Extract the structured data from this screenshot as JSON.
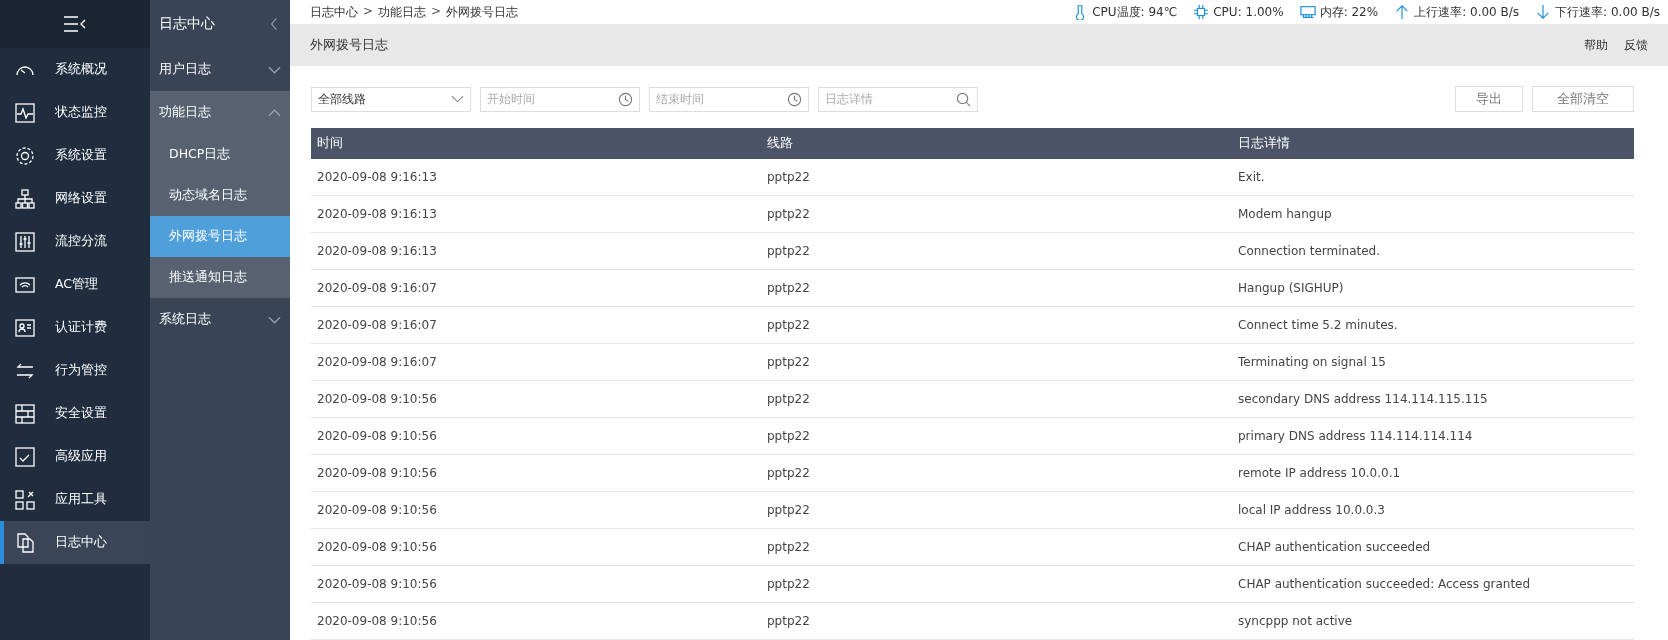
{
  "nav": {
    "items": [
      {
        "label": "系统概况",
        "selected": false
      },
      {
        "label": "状态监控",
        "selected": false
      },
      {
        "label": "系统设置",
        "selected": false
      },
      {
        "label": "网络设置",
        "selected": false
      },
      {
        "label": "流控分流",
        "selected": false
      },
      {
        "label": "AC管理",
        "selected": false
      },
      {
        "label": "认证计费",
        "selected": false
      },
      {
        "label": "行为管控",
        "selected": false
      },
      {
        "label": "安全设置",
        "selected": false
      },
      {
        "label": "高级应用",
        "selected": false
      },
      {
        "label": "应用工具",
        "selected": false
      },
      {
        "label": "日志中心",
        "selected": true
      }
    ]
  },
  "subnav": {
    "title": "日志中心",
    "groups": [
      {
        "label": "用户日志",
        "expanded": false
      },
      {
        "label": "功能日志",
        "expanded": true,
        "children": [
          {
            "label": "DHCP日志",
            "selected": false
          },
          {
            "label": "动态域名日志",
            "selected": false
          },
          {
            "label": "外网拨号日志",
            "selected": true
          },
          {
            "label": "推送通知日志",
            "selected": false
          }
        ]
      },
      {
        "label": "系统日志",
        "expanded": false
      }
    ]
  },
  "breadcrumb": [
    {
      "kind": "link",
      "label": "日志中心"
    },
    {
      "kind": "separator",
      "label": ">"
    },
    {
      "kind": "link",
      "label": "功能日志"
    },
    {
      "kind": "separator",
      "label": ">"
    },
    {
      "kind": "current",
      "label": "外网拨号日志"
    }
  ],
  "status": [
    "CPU温度: 94℃",
    "CPU: 1.00%",
    "内存: 22%",
    "上行速率: 0.00 B/s",
    "下行速率: 0.00 B/s"
  ],
  "page_title": "外网拨号日志",
  "header_links": [
    "帮助",
    "反馈"
  ],
  "filters": {
    "line": "全部线路",
    "start": {
      "placeholder": "开始时间"
    },
    "end": {
      "placeholder": "结束时间"
    },
    "detail": {
      "placeholder": "日志详情"
    }
  },
  "actions": [
    "导出",
    "全部清空"
  ],
  "table": {
    "columns": [
      "时间",
      "线路",
      "日志详情"
    ],
    "rows": [
      [
        "2020-09-08 9:16:13",
        "pptp22",
        "Exit."
      ],
      [
        "2020-09-08 9:16:13",
        "pptp22",
        "Modem hangup"
      ],
      [
        "2020-09-08 9:16:13",
        "pptp22",
        "Connection terminated."
      ],
      [
        "2020-09-08 9:16:07",
        "pptp22",
        "Hangup (SIGHUP)"
      ],
      [
        "2020-09-08 9:16:07",
        "pptp22",
        "Connect time 5.2 minutes."
      ],
      [
        "2020-09-08 9:16:07",
        "pptp22",
        "Terminating on signal 15"
      ],
      [
        "2020-09-08 9:10:56",
        "pptp22",
        "secondary DNS address 114.114.115.115"
      ],
      [
        "2020-09-08 9:10:56",
        "pptp22",
        "primary DNS address 114.114.114.114"
      ],
      [
        "2020-09-08 9:10:56",
        "pptp22",
        "remote IP address 10.0.0.1"
      ],
      [
        "2020-09-08 9:10:56",
        "pptp22",
        "local IP address 10.0.0.3"
      ],
      [
        "2020-09-08 9:10:56",
        "pptp22",
        "CHAP authentication succeeded"
      ],
      [
        "2020-09-08 9:10:56",
        "pptp22",
        "CHAP authentication succeeded: Access granted"
      ],
      [
        "2020-09-08 9:10:56",
        "pptp22",
        "syncppp not active"
      ]
    ]
  }
}
